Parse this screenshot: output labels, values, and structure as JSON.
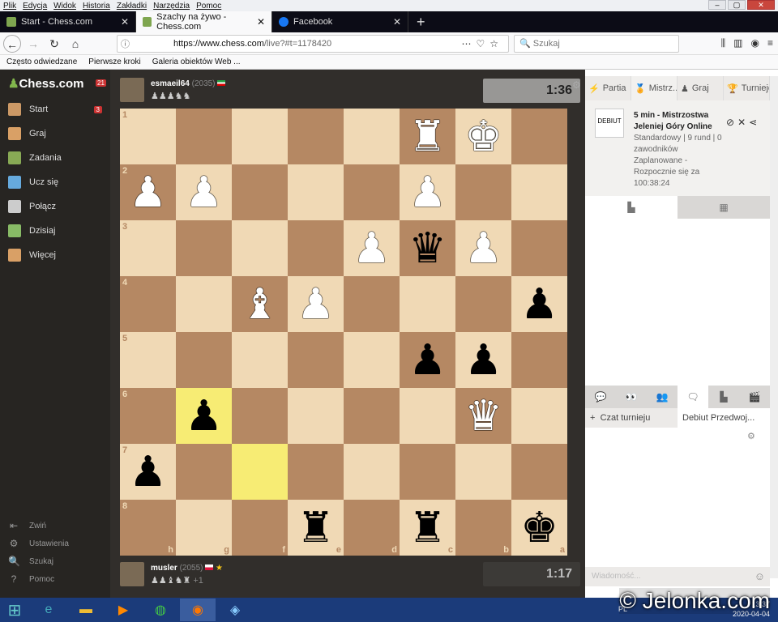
{
  "menu": [
    "Plik",
    "Edycja",
    "Widok",
    "Historia",
    "Zakładki",
    "Narzędzia",
    "Pomoc"
  ],
  "tabs": [
    {
      "label": "Start - Chess.com",
      "active": false
    },
    {
      "label": "Szachy na żywo - Chess.com",
      "active": true
    },
    {
      "label": "Facebook",
      "active": false
    }
  ],
  "url": {
    "host": "https://www.chess.com",
    "path": "/live?#t=1178420"
  },
  "search": {
    "placeholder": "Szukaj"
  },
  "bookmarks": [
    "Często odwiedzane",
    "Pierwsze kroki",
    "Galeria obiektów Web ..."
  ],
  "sidebar": {
    "logo": "Chess.com",
    "logo_badge": "21",
    "items": [
      {
        "label": "Start",
        "badge": "3"
      },
      {
        "label": "Graj",
        "badge": ""
      },
      {
        "label": "Zadania",
        "badge": ""
      },
      {
        "label": "Ucz się",
        "badge": ""
      },
      {
        "label": "Połącz",
        "badge": ""
      },
      {
        "label": "Dzisiaj",
        "badge": ""
      },
      {
        "label": "Więcej",
        "badge": ""
      }
    ],
    "bottom": [
      "Zwiń",
      "Ustawienia",
      "Szukaj",
      "Pomoc"
    ]
  },
  "top_player": {
    "name": "esmaeil64",
    "rating": "(2035)",
    "captured": "♟♟♟♞♞"
  },
  "bottom_player": {
    "name": "musler",
    "rating": "(2055)",
    "captured": "♟♟♝♞♜",
    "extra": "+1"
  },
  "clocks": {
    "top": "1:36",
    "bottom": "1:17"
  },
  "board": {
    "ranks": [
      "1",
      "2",
      "3",
      "4",
      "5",
      "6",
      "7",
      "8"
    ],
    "files": [
      "h",
      "g",
      "f",
      "e",
      "d",
      "c",
      "b",
      "a"
    ],
    "highlight": [
      "g6",
      "f7"
    ],
    "pieces": [
      {
        "sq": "b1",
        "glyph": "♚",
        "color": "w"
      },
      {
        "sq": "c1",
        "glyph": "♜",
        "color": "w"
      },
      {
        "sq": "c2",
        "glyph": "♟",
        "color": "w"
      },
      {
        "sq": "g2",
        "glyph": "♟",
        "color": "w"
      },
      {
        "sq": "h2",
        "glyph": "♟",
        "color": "w"
      },
      {
        "sq": "b3",
        "glyph": "♟",
        "color": "w"
      },
      {
        "sq": "c3",
        "glyph": "♛",
        "color": "b"
      },
      {
        "sq": "d3",
        "glyph": "♟",
        "color": "w"
      },
      {
        "sq": "a4",
        "glyph": "♟",
        "color": "b"
      },
      {
        "sq": "e4",
        "glyph": "♟",
        "color": "w"
      },
      {
        "sq": "f4",
        "glyph": "♝",
        "color": "w"
      },
      {
        "sq": "b5",
        "glyph": "♟",
        "color": "b"
      },
      {
        "sq": "c5",
        "glyph": "♟",
        "color": "b"
      },
      {
        "sq": "b6",
        "glyph": "♛",
        "color": "w"
      },
      {
        "sq": "g6",
        "glyph": "♟",
        "color": "b"
      },
      {
        "sq": "h7",
        "glyph": "♟",
        "color": "b"
      },
      {
        "sq": "a8",
        "glyph": "♚",
        "color": "b"
      },
      {
        "sq": "c8",
        "glyph": "♜",
        "color": "b"
      },
      {
        "sq": "e8",
        "glyph": "♜",
        "color": "b"
      }
    ]
  },
  "right_tabs": [
    "Partia",
    "Mistrz...",
    "Graj",
    "Turnieje"
  ],
  "tournament": {
    "title": "5 min - Mistrzostwa Jeleniej Góry Online",
    "details": "Standardowy | 9 rund | 0 zawodników",
    "status": "Zaplanowane - Rozpocznie się za 100:38:24",
    "logo_text": "DEBIUT"
  },
  "chat": {
    "tab1": "Czat turnieju",
    "tab2": "Debiut Przedwoj...",
    "input_placeholder": "Wiadomość..."
  },
  "taskbar": {
    "lang": "PL",
    "time": "13:37",
    "date": "2020-04-04"
  },
  "watermark": "© Jelonka.com"
}
